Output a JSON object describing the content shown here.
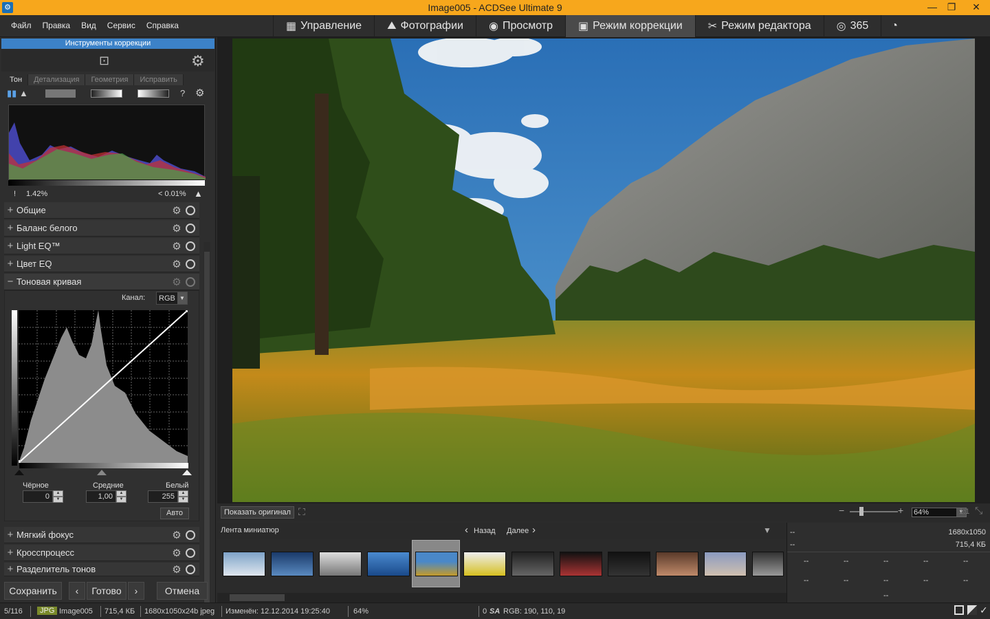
{
  "window": {
    "title": "Image005 - ACDSee Ultimate 9",
    "minimize": "—",
    "restore": "❐",
    "close": "✕"
  },
  "menu": [
    "Файл",
    "Правка",
    "Вид",
    "Сервис",
    "Справка"
  ],
  "modes": [
    {
      "label": "Управление",
      "icon": "grid-icon"
    },
    {
      "label": "Фотографии",
      "icon": "photos-icon"
    },
    {
      "label": "Просмотр",
      "icon": "eye-icon"
    },
    {
      "label": "Режим коррекции",
      "icon": "develop-icon",
      "active": true
    },
    {
      "label": "Режим редактора",
      "icon": "edit-icon"
    },
    {
      "label": "365",
      "icon": "365-icon"
    }
  ],
  "panel": {
    "header": "Инструменты коррекции",
    "tabs": [
      "Тон",
      "Детализация",
      "Геометрия",
      "Исправить"
    ],
    "clip_left": "1.42%",
    "clip_right": "< 0.01%",
    "sections_top": [
      "Общие",
      "Баланс белого",
      "Light EQ™",
      "Цвет EQ"
    ],
    "tone_curve": {
      "title": "Тоновая кривая",
      "channel_label": "Канал:",
      "channel_value": "RGB",
      "black_label": "Чёрное",
      "mid_label": "Средние",
      "white_label": "Белый",
      "black_value": "0",
      "mid_value": "1,00",
      "white_value": "255",
      "auto": "Авто"
    },
    "sections_bottom": [
      "Мягкий фокус",
      "Кросспроцесс",
      "Разделитель тонов"
    ],
    "save": "Сохранить",
    "done": "Готово",
    "cancel": "Отмена"
  },
  "viewer": {
    "show_original": "Показать оригинал",
    "zoom": "64%",
    "one_to_one": "1:1"
  },
  "filmstrip": {
    "title": "Лента миниатюр",
    "back": "Назад",
    "next": "Далее"
  },
  "info": {
    "dim": "1680x1050",
    "size": "715,4 КБ",
    "dash": "--"
  },
  "status": {
    "index": "5/116",
    "format": "JPG",
    "name": "Image005",
    "size": "715,4 КБ",
    "dims": "1680x1050x24b jpeg",
    "modified": "Изменён: 12.12.2014 19:25:40",
    "zoom": "64%",
    "rgb": "RGB: 190, 110, 19",
    "coords": "0"
  },
  "colors": {
    "accent": "#f7a71c",
    "header": "#3c82c8"
  }
}
